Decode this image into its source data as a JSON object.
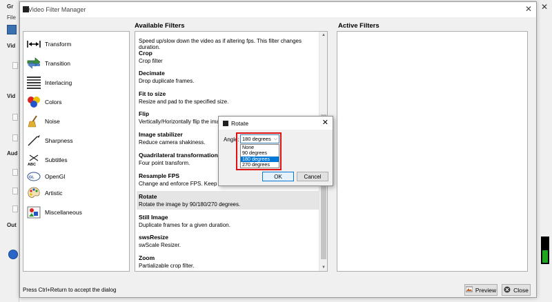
{
  "background": {
    "left_labels": [
      "Vid",
      "Vid",
      "Aud",
      "Out"
    ],
    "file_menu": "File",
    "app_title_fragment": "Gr"
  },
  "dialog": {
    "title": "Video Filter Manager",
    "available_header": "Available Filters",
    "active_header": "Active Filters",
    "hint": "Press Ctrl+Return to accept the dialog",
    "preview_label": "Preview",
    "close_label": "Close"
  },
  "categories": [
    {
      "label": "Transform",
      "icon": "transform-icon"
    },
    {
      "label": "Transition",
      "icon": "transition-icon"
    },
    {
      "label": "Interlacing",
      "icon": "interlacing-icon"
    },
    {
      "label": "Colors",
      "icon": "colors-icon"
    },
    {
      "label": "Noise",
      "icon": "noise-icon"
    },
    {
      "label": "Sharpness",
      "icon": "sharpness-icon"
    },
    {
      "label": "Subtitles",
      "icon": "subtitles-icon"
    },
    {
      "label": "OpenGl",
      "icon": "opengl-icon"
    },
    {
      "label": "Artistic",
      "icon": "artistic-icon"
    },
    {
      "label": "Miscellaneous",
      "icon": "miscellaneous-icon"
    }
  ],
  "filters": [
    {
      "name": "",
      "desc": "Speed up/slow down the video as if altering fps. This filter changes duration."
    },
    {
      "name": "Crop",
      "desc": "Crop filter"
    },
    {
      "name": "Decimate",
      "desc": "Drop duplicate frames."
    },
    {
      "name": "Fit to size",
      "desc": "Resize and pad to the specified size."
    },
    {
      "name": "Flip",
      "desc": "Vertically/Horizontally flip the image."
    },
    {
      "name": "Image stabilizer",
      "desc": "Reduce camera shakiness."
    },
    {
      "name": "Quadrilateral transformation",
      "desc": "Four point transform."
    },
    {
      "name": "Resample FPS",
      "desc": "Change and enforce FPS. Keep duration"
    },
    {
      "name": "Rotate",
      "desc": "Rotate the image by 90/180/270 degrees."
    },
    {
      "name": "Still Image",
      "desc": "Duplicate frames for a given duration."
    },
    {
      "name": "swsResize",
      "desc": "swScale Resizer."
    },
    {
      "name": "Zoom",
      "desc": "Partializable crop filter."
    }
  ],
  "rotate": {
    "title": "Rotate",
    "angle_label": "Angle:",
    "selected": "180 degrees",
    "options": [
      "None",
      "90 degrees",
      "180 degrees",
      "270 degrees"
    ],
    "highlighted_index": 2,
    "ok_label": "OK",
    "cancel_label": "Cancel"
  },
  "colors": {
    "highlight": "#0078d7",
    "annotation_box": "#e01010",
    "selected_row": "#e5e5e5"
  }
}
